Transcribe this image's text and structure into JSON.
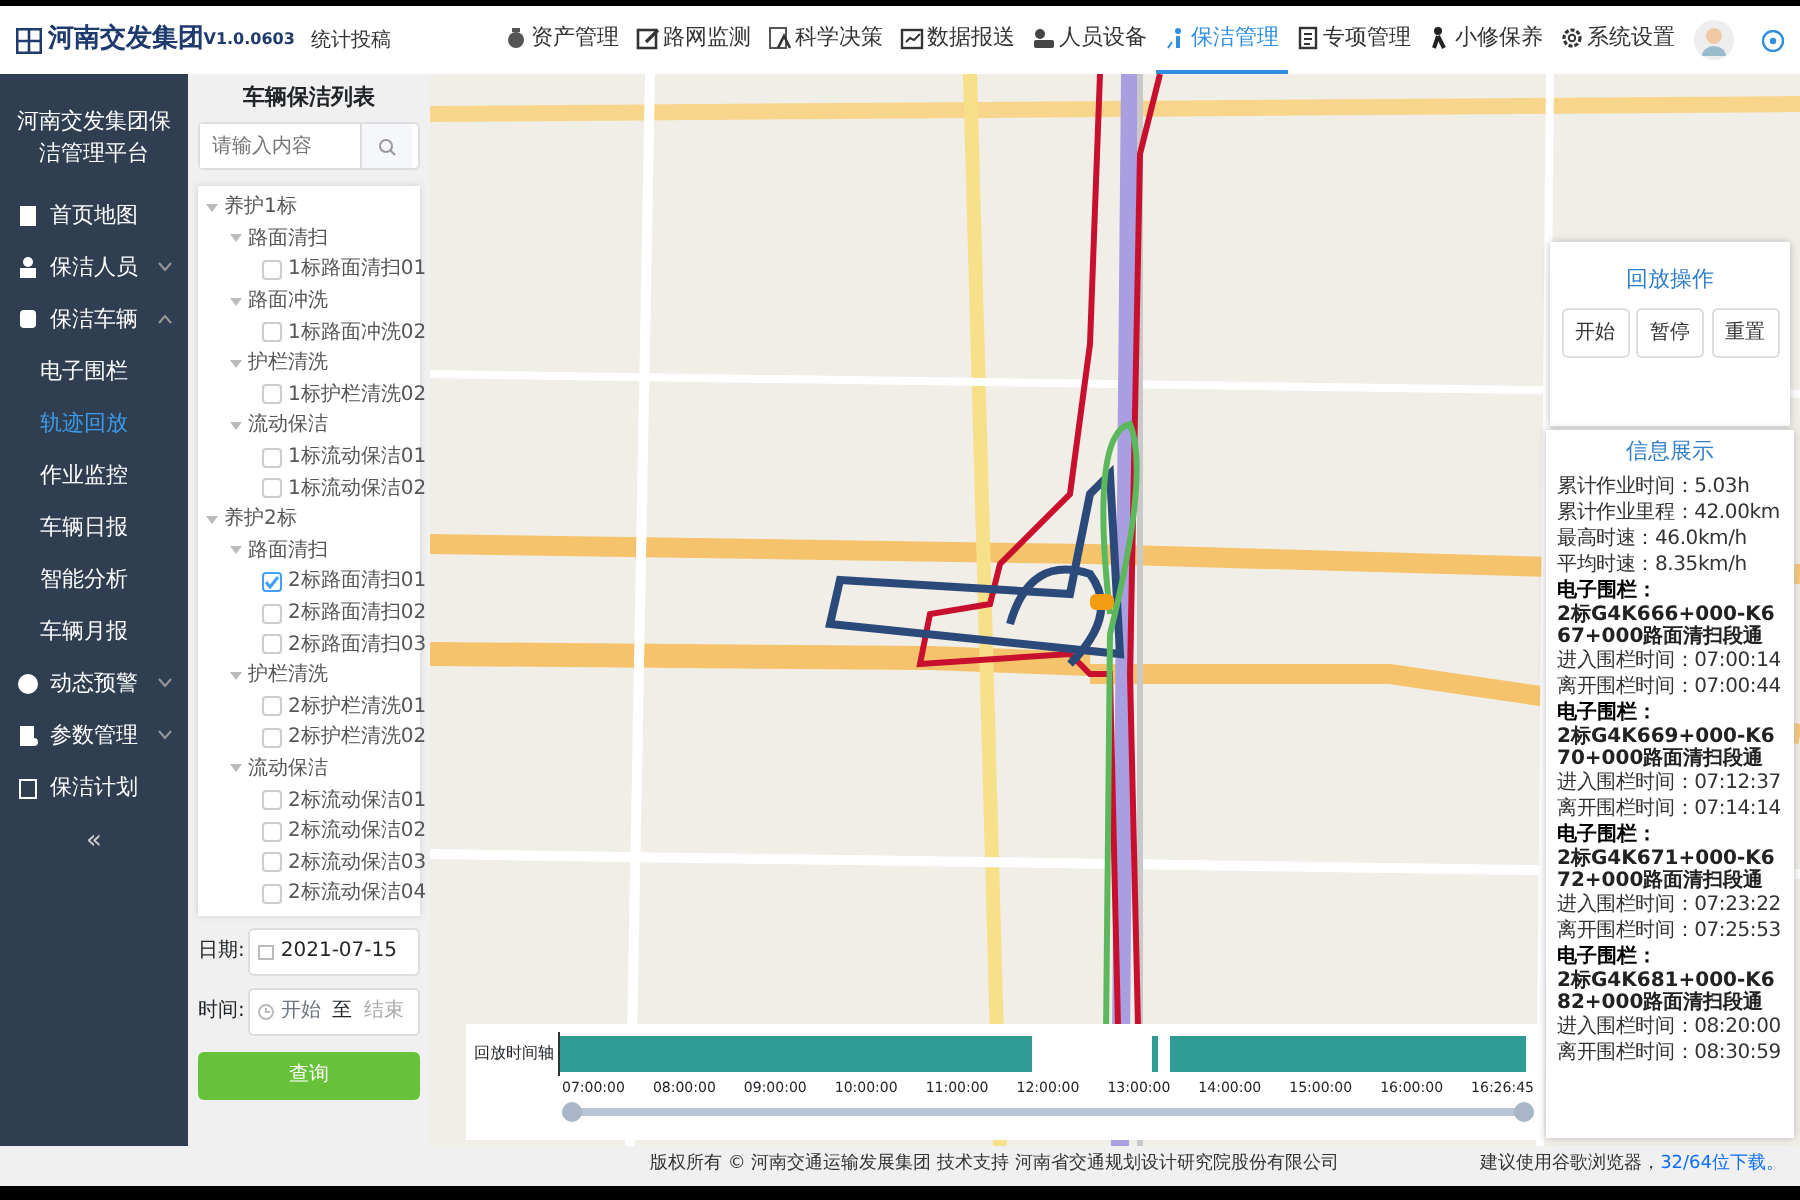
{
  "header": {
    "logo_text": "河南交发集团",
    "version": "V1.0.0603",
    "subtitle": "统计投稿"
  },
  "nav": [
    {
      "label": "资产管理",
      "selected": false
    },
    {
      "label": "路网监测",
      "selected": false
    },
    {
      "label": "科学决策",
      "selected": false
    },
    {
      "label": "数据报送",
      "selected": false
    },
    {
      "label": "人员设备",
      "selected": false
    },
    {
      "label": "保洁管理",
      "selected": true
    },
    {
      "label": "专项管理",
      "selected": false
    },
    {
      "label": "小修保养",
      "selected": false
    },
    {
      "label": "系统设置",
      "selected": false
    }
  ],
  "sidebar": {
    "title": "河南交发集团保洁管理平台",
    "collapse": "«",
    "items": [
      {
        "label": "首页地图"
      },
      {
        "label": "保洁人员",
        "expanded": false
      },
      {
        "label": "保洁车辆",
        "expanded": true,
        "children": [
          {
            "label": "电子围栏",
            "selected": false
          },
          {
            "label": "轨迹回放",
            "selected": true
          },
          {
            "label": "作业监控",
            "selected": false
          },
          {
            "label": "车辆日报",
            "selected": false
          },
          {
            "label": "智能分析",
            "selected": false
          },
          {
            "label": "车辆月报",
            "selected": false
          }
        ]
      },
      {
        "label": "动态预警",
        "expanded": false
      },
      {
        "label": "参数管理",
        "expanded": false
      },
      {
        "label": "保洁计划"
      }
    ]
  },
  "vehicle_panel": {
    "title": "车辆保洁列表",
    "search": {
      "placeholder": "请输入内容"
    },
    "tree": [
      {
        "label": "养护1标",
        "children": [
          {
            "label": "路面清扫",
            "children": [
              {
                "label": "1标路面清扫01",
                "checked": false
              }
            ]
          },
          {
            "label": "路面冲洗",
            "children": [
              {
                "label": "1标路面冲洗02",
                "checked": false
              }
            ]
          },
          {
            "label": "护栏清洗",
            "children": [
              {
                "label": "1标护栏清洗02",
                "checked": false
              }
            ]
          },
          {
            "label": "流动保洁",
            "children": [
              {
                "label": "1标流动保洁01",
                "checked": false
              },
              {
                "label": "1标流动保洁02",
                "checked": false
              }
            ]
          }
        ]
      },
      {
        "label": "养护2标",
        "children": [
          {
            "label": "路面清扫",
            "children": [
              {
                "label": "2标路面清扫01",
                "checked": true
              },
              {
                "label": "2标路面清扫02",
                "checked": false
              },
              {
                "label": "2标路面清扫03",
                "checked": false
              }
            ]
          },
          {
            "label": "护栏清洗",
            "children": [
              {
                "label": "2标护栏清洗01",
                "checked": false
              },
              {
                "label": "2标护栏清洗02",
                "checked": false
              }
            ]
          },
          {
            "label": "流动保洁",
            "children": [
              {
                "label": "2标流动保洁01",
                "checked": false
              },
              {
                "label": "2标流动保洁02",
                "checked": false
              },
              {
                "label": "2标流动保洁03",
                "checked": false
              },
              {
                "label": "2标流动保洁04",
                "checked": false
              }
            ]
          }
        ]
      }
    ],
    "date_label": "日期:",
    "date_value": "2021-07-15",
    "time_label": "时间:",
    "time_start_placeholder": "开始",
    "time_separator": "至",
    "time_end_placeholder": "结束",
    "query_button": "查询"
  },
  "playback": {
    "title": "回放操作",
    "buttons": [
      "开始",
      "暂停",
      "重置"
    ]
  },
  "info": {
    "title": "信息展示",
    "stats": [
      "累计作业时间：5.03h",
      "累计作业里程：42.00km",
      "最高时速：46.0km/h",
      "平均时速：8.35km/h"
    ],
    "fences": [
      {
        "heading": "电子围栏：",
        "code": "2标G4K666+000-K667+000路面清扫段通",
        "enter": "进入围栏时间：07:00:14",
        "leave": "离开围栏时间：07:00:44"
      },
      {
        "heading": "电子围栏：",
        "code": "2标G4K669+000-K670+000路面清扫段通",
        "enter": "进入围栏时间：07:12:37",
        "leave": "离开围栏时间：07:14:14"
      },
      {
        "heading": "电子围栏：",
        "code": "2标G4K671+000-K672+000路面清扫段通",
        "enter": "进入围栏时间：07:23:22",
        "leave": "离开围栏时间：07:25:53"
      },
      {
        "heading": "电子围栏：",
        "code": "2标G4K681+000-K682+000路面清扫段通",
        "enter": "进入围栏时间：08:20:00",
        "leave": "离开围栏时间：08:30:59"
      }
    ]
  },
  "timeline": {
    "label": "回放时间轴",
    "ticks": [
      "07:00:00",
      "08:00:00",
      "09:00:00",
      "10:00:00",
      "11:00:00",
      "12:00:00",
      "13:00:00",
      "14:00:00",
      "15:00:00",
      "16:00:00",
      "16:26:45"
    ],
    "slider": {
      "level": 1
    }
  },
  "footer": {
    "copyright": "版权所有 © 河南交通运输发展集团 技术支持 河南省交通规划设计研究院股份有限公司",
    "browser_note": "建议使用谷歌浏览器，",
    "download_link": "32/64位下载。"
  }
}
